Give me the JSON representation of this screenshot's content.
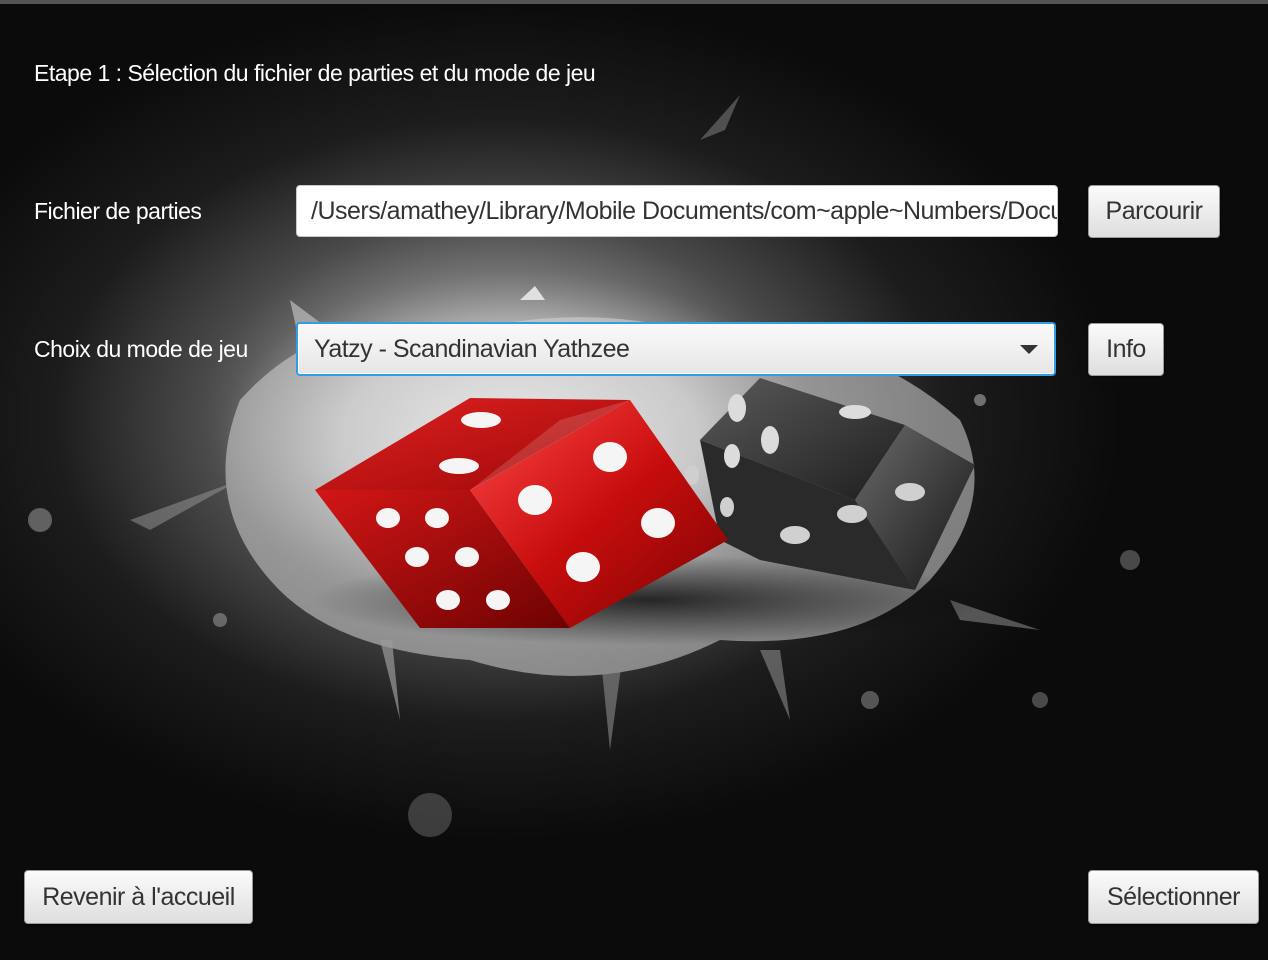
{
  "header": {
    "step_title": "Etape 1 : Sélection du fichier de parties et du mode de jeu"
  },
  "file_row": {
    "label": "Fichier de parties",
    "path_value": "/Users/amathey/Library/Mobile Documents/com~apple~Numbers/Documents/parties.csv",
    "browse_label": "Parcourir"
  },
  "mode_row": {
    "label": "Choix du mode de jeu",
    "selected_mode": "Yatzy - Scandinavian Yathzee",
    "info_label": "Info"
  },
  "footer": {
    "back_label": "Revenir à l'accueil",
    "select_label": "Sélectionner"
  },
  "background": {
    "image_subject": "red-and-black-dice-on-paint-splash",
    "colors": {
      "red_die": "#c41010",
      "black_die": "#222222",
      "select_focus": "#2e9ee6",
      "text": "#ffffff"
    }
  }
}
